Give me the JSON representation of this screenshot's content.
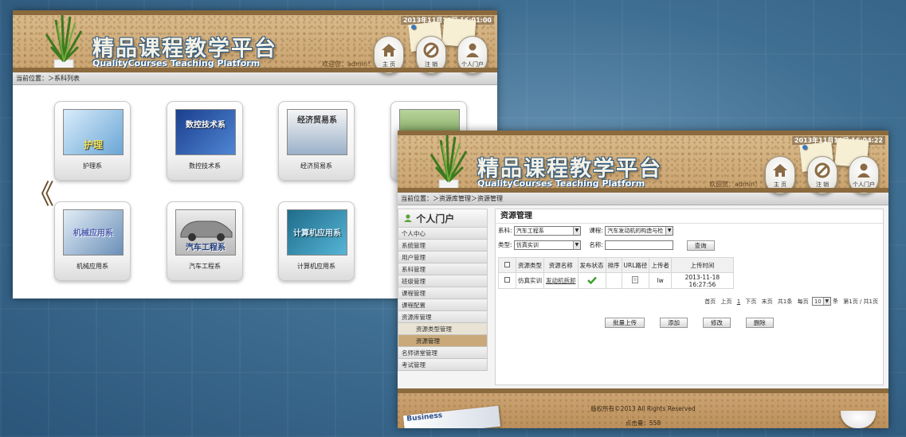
{
  "window_a": {
    "title": "精品课程教学平台",
    "subtitle": "QualityCourses Teaching Platform",
    "clock": "2013年11月18日 16:01:00",
    "welcome": "欢迎您：admin！",
    "nav": {
      "home": "主 页",
      "logout": "注 销",
      "portal": "个人门户"
    },
    "breadcrumb": "当前位置：＞系科列表",
    "departments": [
      {
        "name": "护理系",
        "thumb_text": "护理"
      },
      {
        "name": "数控技术系",
        "thumb_text": "数控技术系"
      },
      {
        "name": "经济贸易系",
        "thumb_text": "经济贸易系"
      },
      {
        "name": "",
        "thumb_text": ""
      },
      {
        "name": "机械应用系",
        "thumb_text": "机械应用系"
      },
      {
        "name": "汽车工程系",
        "thumb_text": "汽车工程系"
      },
      {
        "name": "计算机应用系",
        "thumb_text": "计算机应用系"
      }
    ],
    "prev_arrow": "《"
  },
  "window_b": {
    "title": "精品课程教学平台",
    "subtitle": "QualityCourses Teaching Platform",
    "clock": "2013年11月18日 16:04:22",
    "welcome": "欢迎您：admin！",
    "nav": {
      "home": "主 页",
      "logout": "注 销",
      "portal": "个人门户"
    },
    "breadcrumb": "当前位置：＞资源库管理＞资源管理",
    "sidebar": {
      "title": "个人门户",
      "items": [
        "个人中心",
        "系统管理",
        "用户管理",
        "系科管理",
        "班级管理",
        "课程管理",
        "课程配置",
        "资源库管理"
      ],
      "sub_items": [
        "资源类型管理",
        "资源管理"
      ],
      "items_after": [
        "名师讲堂管理",
        "考试管理"
      ]
    },
    "panel": {
      "title": "资源管理",
      "dept_label": "系科:",
      "dept_value": "汽车工程系",
      "course_label": "课程:",
      "course_value": "汽车发动机的构造与检",
      "type_label": "类型:",
      "type_value": "仿真实训",
      "name_label": "名称:",
      "name_value": "",
      "search_button": "查询",
      "columns": [
        "资源类型",
        "资源名称",
        "发布状态",
        "排序",
        "URL路径",
        "上传者",
        "上传时间"
      ],
      "rows": [
        {
          "type": "仿真实训",
          "name": "发动机拆卸",
          "status_icon": "check-icon",
          "order": "",
          "url_icon": "document-icon",
          "uploader": "lw",
          "time": "2013-11-18 16:27:56"
        }
      ],
      "pager": {
        "first": "首页",
        "prev": "上页",
        "current": "1",
        "next": "下页",
        "last": "末页",
        "total": "共1条",
        "per_page_label": "每页",
        "per_page": "10",
        "unit": "条",
        "pages": "第1页 / 共1页"
      },
      "actions": [
        "批量上传",
        "添加",
        "修改",
        "删除"
      ]
    },
    "footer": {
      "copyright": "版权所有©2013 All Rights Reserved",
      "hits": "点击量：558",
      "paper_text": "Business"
    }
  },
  "colors": {
    "background": "#3f6f93",
    "cork": "#c9a36f",
    "title_outline": "#2f5a80",
    "check": "#3aa12a"
  }
}
